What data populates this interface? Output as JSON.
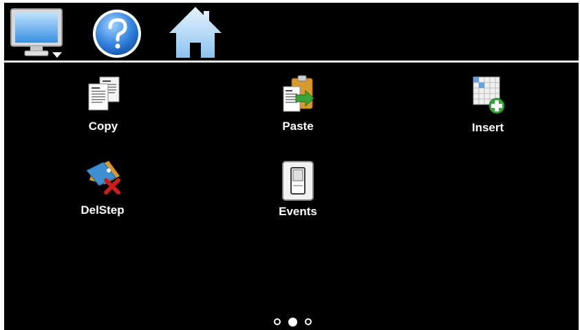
{
  "colors": {
    "background": "#000000",
    "divider": "#e8e8e8",
    "label": "#ffffff"
  },
  "toolbar": {
    "buttons": [
      {
        "icon": "monitor-icon"
      },
      {
        "icon": "help-icon"
      },
      {
        "icon": "home-icon"
      }
    ]
  },
  "tiles": [
    {
      "label": "Copy",
      "icon": "copy-icon"
    },
    {
      "label": "Paste",
      "icon": "paste-icon"
    },
    {
      "label": "Insert",
      "icon": "insert-icon"
    },
    {
      "label": "DelStep",
      "icon": "delete-step-icon"
    },
    {
      "label": "Events",
      "icon": "events-switch-icon"
    }
  ],
  "pager": {
    "pages": 3,
    "current": 2
  }
}
